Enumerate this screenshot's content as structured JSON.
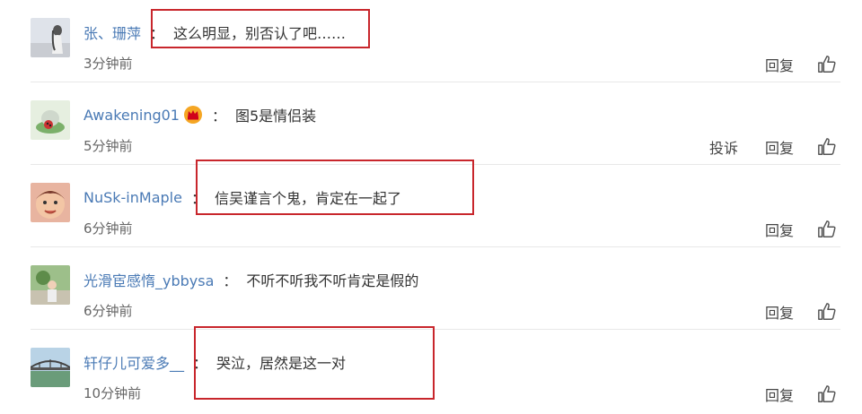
{
  "comments": [
    {
      "username": "张、珊萍",
      "colon": "：",
      "text": "这么明显，别否认了吧……",
      "time": "3分钟前",
      "actions": [
        "回复"
      ],
      "badge": false,
      "avatar_icon": "avatar-girl-icon"
    },
    {
      "username": "Awakening01",
      "colon": "：",
      "text": "图5是情侣装",
      "time": "5分钟前",
      "actions": [
        "投诉",
        "回复"
      ],
      "badge": true,
      "avatar_icon": "avatar-ladybug-icon"
    },
    {
      "username": "NuSk-inMaple",
      "colon": "：",
      "text": "信吴谨言个鬼，肯定在一起了",
      "time": "6分钟前",
      "actions": [
        "回复"
      ],
      "badge": false,
      "avatar_icon": "avatar-baby-icon"
    },
    {
      "username": "光滑宦感惰_ybbysa",
      "colon": "：",
      "text": "不听不听我不听肯定是假的",
      "time": "6分钟前",
      "actions": [
        "回复"
      ],
      "badge": false,
      "avatar_icon": "avatar-photo-icon"
    },
    {
      "username": "轩仔儿可爱多__",
      "colon": "：",
      "text": "哭泣，居然是这一对",
      "time": "10分钟前",
      "actions": [
        "回复"
      ],
      "badge": false,
      "avatar_icon": "avatar-bridge-icon"
    }
  ],
  "colors": {
    "username": "#4a7ab5",
    "highlight": "#c8262c",
    "divider": "#e8e8e8"
  }
}
